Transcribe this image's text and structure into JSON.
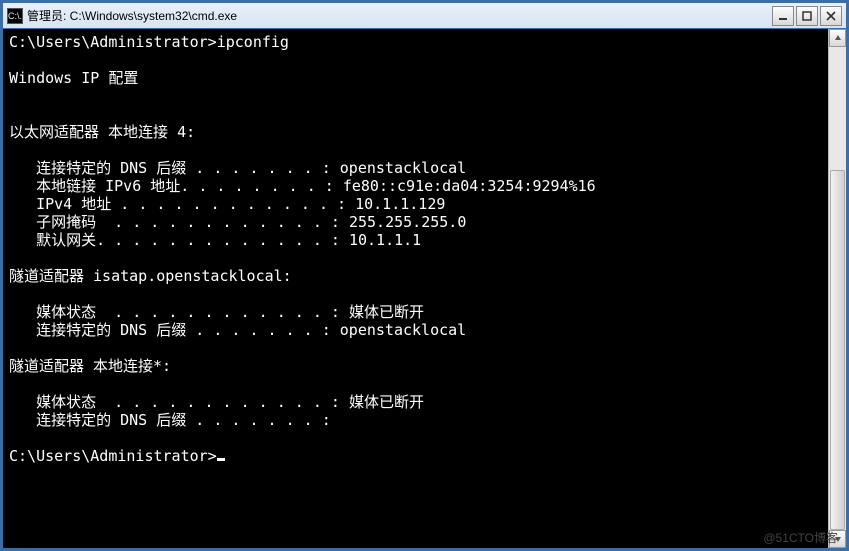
{
  "window": {
    "icon_glyph": "C:\\.",
    "title": "管理员: C:\\Windows\\system32\\cmd.exe"
  },
  "terminal": {
    "prompt1": "C:\\Users\\Administrator>",
    "command": "ipconfig",
    "header": "Windows IP 配置",
    "adapter1": {
      "title": "以太网适配器 本地连接 4:",
      "dns_suffix_label": "   连接特定的 DNS 后缀 . . . . . . . : ",
      "dns_suffix_value": "openstacklocal",
      "ipv6_label": "   本地链接 IPv6 地址. . . . . . . . : ",
      "ipv6_value": "fe80::c91e:da04:3254:9294%16",
      "ipv4_label": "   IPv4 地址 . . . . . . . . . . . . : ",
      "ipv4_value": "10.1.1.129",
      "mask_label": "   子网掩码  . . . . . . . . . . . . : ",
      "mask_value": "255.255.255.0",
      "gw_label": "   默认网关. . . . . . . . . . . . . : ",
      "gw_value": "10.1.1.1"
    },
    "adapter2": {
      "title": "隧道适配器 isatap.openstacklocal:",
      "media_label": "   媒体状态  . . . . . . . . . . . . : ",
      "media_value": "媒体已断开",
      "dns_suffix_label": "   连接特定的 DNS 后缀 . . . . . . . : ",
      "dns_suffix_value": "openstacklocal"
    },
    "adapter3": {
      "title": "隧道适配器 本地连接*:",
      "media_label": "   媒体状态  . . . . . . . . . . . . : ",
      "media_value": "媒体已断开",
      "dns_suffix_label": "   连接特定的 DNS 后缀 . . . . . . . :",
      "dns_suffix_value": ""
    },
    "prompt2": "C:\\Users\\Administrator>"
  },
  "watermark": "@51CTO博客"
}
